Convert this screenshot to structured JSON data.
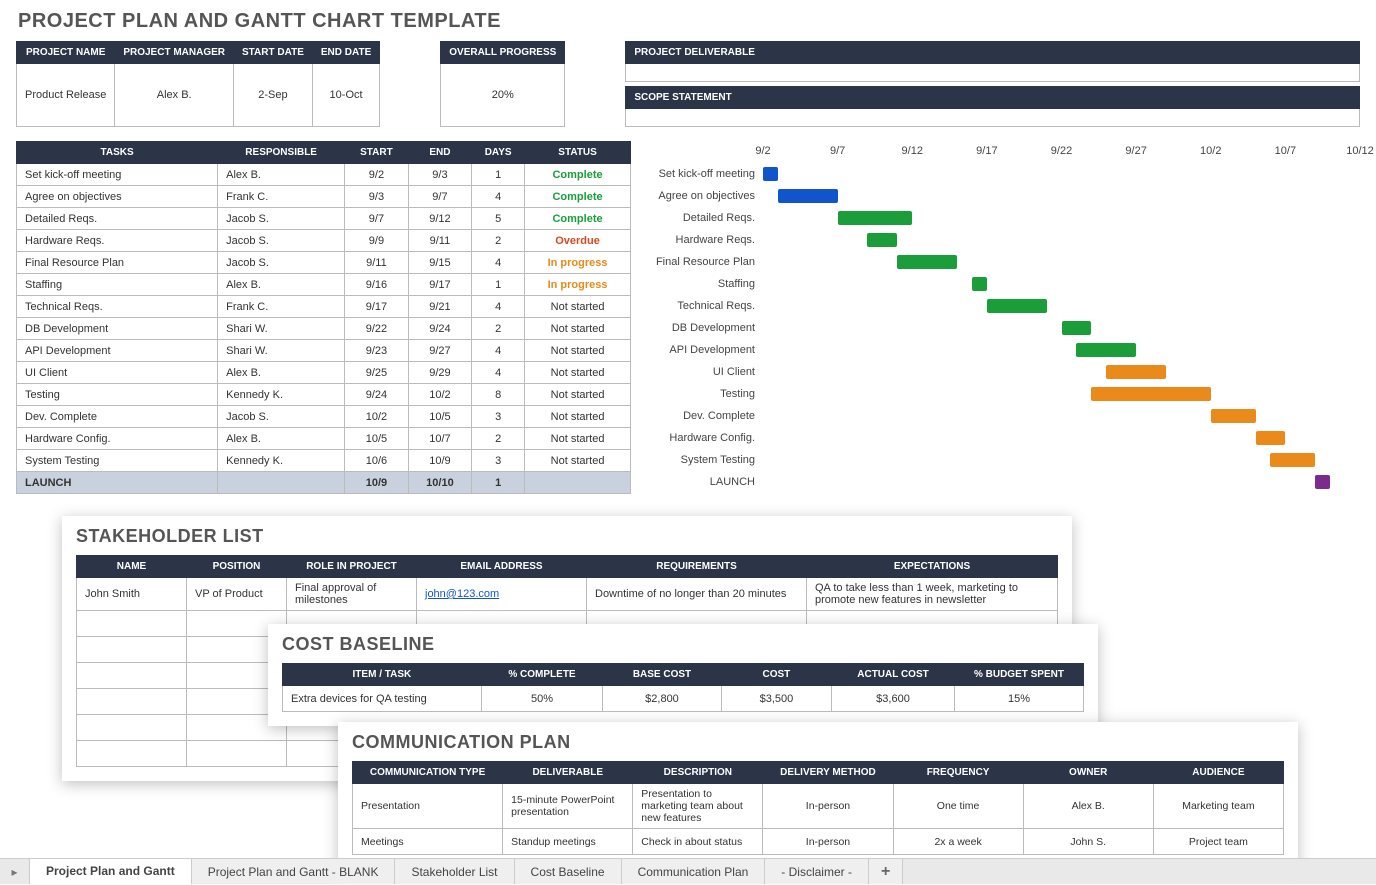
{
  "title": "PROJECT PLAN AND GANTT CHART TEMPLATE",
  "info_headers": [
    "PROJECT NAME",
    "PROJECT MANAGER",
    "START DATE",
    "END DATE"
  ],
  "info_values": [
    "Product Release",
    "Alex B.",
    "2-Sep",
    "10-Oct"
  ],
  "overall_progress_label": "OVERALL PROGRESS",
  "overall_progress": "20%",
  "deliverable_label": "PROJECT DELIVERABLE",
  "scope_label": "SCOPE STATEMENT",
  "task_headers": [
    "TASKS",
    "RESPONSIBLE",
    "START",
    "END",
    "DAYS",
    "STATUS"
  ],
  "tasks": [
    {
      "t": "Set kick-off meeting",
      "r": "Alex B.",
      "s": "9/2",
      "e": "9/3",
      "d": "1",
      "st": "Complete",
      "cls": "status-complete"
    },
    {
      "t": "Agree on objectives",
      "r": "Frank C.",
      "s": "9/3",
      "e": "9/7",
      "d": "4",
      "st": "Complete",
      "cls": "status-complete"
    },
    {
      "t": "Detailed Reqs.",
      "r": "Jacob S.",
      "s": "9/7",
      "e": "9/12",
      "d": "5",
      "st": "Complete",
      "cls": "status-complete"
    },
    {
      "t": "Hardware Reqs.",
      "r": "Jacob S.",
      "s": "9/9",
      "e": "9/11",
      "d": "2",
      "st": "Overdue",
      "cls": "status-overdue"
    },
    {
      "t": "Final Resource Plan",
      "r": "Jacob S.",
      "s": "9/11",
      "e": "9/15",
      "d": "4",
      "st": "In progress",
      "cls": "status-progress"
    },
    {
      "t": "Staffing",
      "r": "Alex B.",
      "s": "9/16",
      "e": "9/17",
      "d": "1",
      "st": "In progress",
      "cls": "status-progress"
    },
    {
      "t": "Technical Reqs.",
      "r": "Frank C.",
      "s": "9/17",
      "e": "9/21",
      "d": "4",
      "st": "Not started",
      "cls": ""
    },
    {
      "t": "DB Development",
      "r": "Shari W.",
      "s": "9/22",
      "e": "9/24",
      "d": "2",
      "st": "Not started",
      "cls": ""
    },
    {
      "t": "API Development",
      "r": "Shari W.",
      "s": "9/23",
      "e": "9/27",
      "d": "4",
      "st": "Not started",
      "cls": ""
    },
    {
      "t": "UI Client",
      "r": "Alex B.",
      "s": "9/25",
      "e": "9/29",
      "d": "4",
      "st": "Not started",
      "cls": ""
    },
    {
      "t": "Testing",
      "r": "Kennedy K.",
      "s": "9/24",
      "e": "10/2",
      "d": "8",
      "st": "Not started",
      "cls": ""
    },
    {
      "t": "Dev. Complete",
      "r": "Jacob S.",
      "s": "10/2",
      "e": "10/5",
      "d": "3",
      "st": "Not started",
      "cls": ""
    },
    {
      "t": "Hardware Config.",
      "r": "Alex B.",
      "s": "10/5",
      "e": "10/7",
      "d": "2",
      "st": "Not started",
      "cls": ""
    },
    {
      "t": "System Testing",
      "r": "Kennedy K.",
      "s": "10/6",
      "e": "10/9",
      "d": "3",
      "st": "Not started",
      "cls": ""
    }
  ],
  "launch": {
    "t": "LAUNCH",
    "s": "10/9",
    "e": "10/10",
    "d": "1"
  },
  "chart_data": {
    "type": "gantt",
    "x_ticks": [
      "9/2",
      "9/7",
      "9/12",
      "9/17",
      "9/22",
      "9/27",
      "10/2",
      "10/7",
      "10/12"
    ],
    "x_start": "9/2",
    "x_end": "10/12",
    "series": [
      {
        "name": "Set kick-off meeting",
        "start": "9/2",
        "end": "9/3",
        "color": "blue"
      },
      {
        "name": "Agree on objectives",
        "start": "9/3",
        "end": "9/7",
        "color": "blue"
      },
      {
        "name": "Detailed Reqs.",
        "start": "9/7",
        "end": "9/12",
        "color": "green"
      },
      {
        "name": "Hardware Reqs.",
        "start": "9/9",
        "end": "9/11",
        "color": "green"
      },
      {
        "name": "Final Resource Plan",
        "start": "9/11",
        "end": "9/15",
        "color": "green"
      },
      {
        "name": "Staffing",
        "start": "9/16",
        "end": "9/17",
        "color": "green"
      },
      {
        "name": "Technical Reqs.",
        "start": "9/17",
        "end": "9/21",
        "color": "green"
      },
      {
        "name": "DB Development",
        "start": "9/22",
        "end": "9/24",
        "color": "green"
      },
      {
        "name": "API Development",
        "start": "9/23",
        "end": "9/27",
        "color": "green"
      },
      {
        "name": "UI Client",
        "start": "9/25",
        "end": "9/29",
        "color": "orange"
      },
      {
        "name": "Testing",
        "start": "9/24",
        "end": "10/2",
        "color": "orange"
      },
      {
        "name": "Dev. Complete",
        "start": "10/2",
        "end": "10/5",
        "color": "orange"
      },
      {
        "name": "Hardware Config.",
        "start": "10/5",
        "end": "10/7",
        "color": "orange"
      },
      {
        "name": "System Testing",
        "start": "10/6",
        "end": "10/9",
        "color": "orange"
      },
      {
        "name": "LAUNCH",
        "start": "10/9",
        "end": "10/10",
        "color": "purple"
      }
    ]
  },
  "stake": {
    "title": "STAKEHOLDER LIST",
    "headers": [
      "NAME",
      "POSITION",
      "ROLE IN PROJECT",
      "EMAIL ADDRESS",
      "REQUIREMENTS",
      "EXPECTATIONS"
    ],
    "rows": [
      {
        "name": "John Smith",
        "pos": "VP of Product",
        "role": "Final approval of milestones",
        "email": "john@123.com",
        "req": "Downtime of no longer than 20 minutes",
        "exp": "QA to take less than 1 week, marketing to promote new features in newsletter"
      }
    ],
    "blank_rows": 6
  },
  "cost": {
    "title": "COST BASELINE",
    "headers": [
      "ITEM / TASK",
      "% COMPLETE",
      "BASE COST",
      "COST",
      "ACTUAL COST",
      "% BUDGET SPENT"
    ],
    "rows": [
      [
        "Extra devices for QA testing",
        "50%",
        "$2,800",
        "$3,500",
        "$3,600",
        "15%"
      ]
    ]
  },
  "comm": {
    "title": "COMMUNICATION PLAN",
    "headers": [
      "COMMUNICATION TYPE",
      "DELIVERABLE",
      "DESCRIPTION",
      "DELIVERY METHOD",
      "FREQUENCY",
      "OWNER",
      "AUDIENCE"
    ],
    "rows": [
      [
        "Presentation",
        "15-minute PowerPoint presentation",
        "Presentation to marketing team about new features",
        "In-person",
        "One time",
        "Alex B.",
        "Marketing team"
      ],
      [
        "Meetings",
        "Standup meetings",
        "Check in about status",
        "In-person",
        "2x a week",
        "John S.",
        "Project team"
      ]
    ]
  },
  "tabs": [
    "Project Plan and Gantt",
    "Project Plan and Gantt - BLANK",
    "Stakeholder List",
    "Cost Baseline",
    "Communication Plan",
    "- Disclaimer -"
  ],
  "active_tab": 0
}
